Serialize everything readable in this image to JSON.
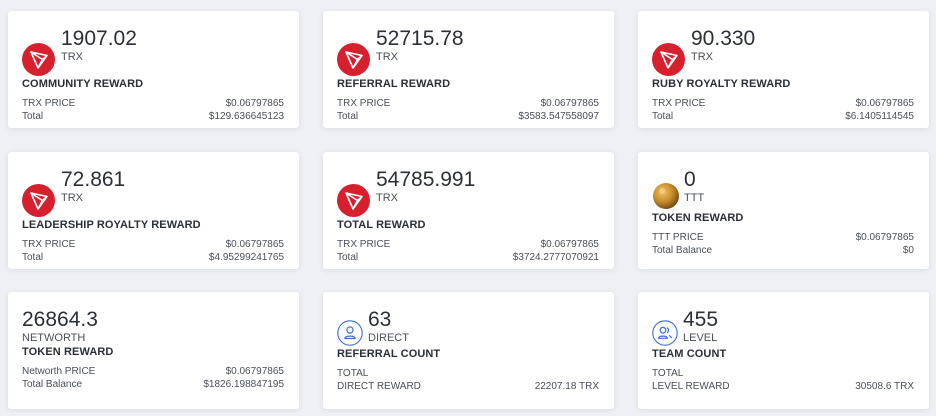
{
  "cards": [
    {
      "amount": "1907.02",
      "unit": "TRX",
      "label": "COMMUNITY REWARD",
      "row1_label": "TRX PRICE",
      "row1_value": "$0.06797865",
      "row2_label": "Total",
      "row2_value": "$129.636645123",
      "icon": "tron-icon"
    },
    {
      "amount": "52715.78",
      "unit": "TRX",
      "label": "REFERRAL REWARD",
      "row1_label": "TRX PRICE",
      "row1_value": "$0.06797865",
      "row2_label": "Total",
      "row2_value": "$3583.547558097",
      "icon": "tron-icon"
    },
    {
      "amount": "90.330",
      "unit": "TRX",
      "label": "RUBY ROYALTY REWARD",
      "row1_label": "TRX PRICE",
      "row1_value": "$0.06797865",
      "row2_label": "Total",
      "row2_value": "$6.1405114545",
      "icon": "tron-icon"
    },
    {
      "amount": "72.861",
      "unit": "TRX",
      "label": "LEADERSHIP ROYALTY REWARD",
      "row1_label": "TRX PRICE",
      "row1_value": "$0.06797865",
      "row2_label": "Total",
      "row2_value": "$4.95299241765",
      "icon": "tron-icon"
    },
    {
      "amount": "54785.991",
      "unit": "TRX",
      "label": "TOTAL REWARD",
      "row1_label": "TRX PRICE",
      "row1_value": "$0.06797865",
      "row2_label": "Total",
      "row2_value": "$3724.2777070921",
      "icon": "tron-icon"
    },
    {
      "amount": "0",
      "unit": "TTT",
      "label": "TOKEN REWARD",
      "row1_label": "TTT PRICE",
      "row1_value": "$0.06797865",
      "row2_label": "Total Balance",
      "row2_value": "$0",
      "icon": "coin-icon"
    },
    {
      "amount": "26864.3",
      "unit": "NETWORTH",
      "label": "TOKEN REWARD",
      "row1_label": "Networth PRICE",
      "row1_value": "$0.06797865",
      "row2_label": "Total Balance",
      "row2_value": "$1826.198847195",
      "icon": ""
    },
    {
      "amount": "63",
      "unit": "DIRECT",
      "label": "REFERRAL COUNT",
      "row1_label": "TOTAL",
      "row1_value": "",
      "row2_label": "DIRECT REWARD",
      "row2_value": "22207.18 TRX",
      "icon": "user-icon"
    },
    {
      "amount": "455",
      "unit": "LEVEL",
      "label": "TEAM COUNT",
      "row1_label": "TOTAL",
      "row1_value": "",
      "row2_label": "LEVEL REWARD",
      "row2_value": "30508.6 TRX",
      "icon": "users-icon"
    }
  ],
  "colors": {
    "tron_red": "#d6202e",
    "accent_blue": "#3d6fd6",
    "coin_gold": "#c48a2a"
  }
}
